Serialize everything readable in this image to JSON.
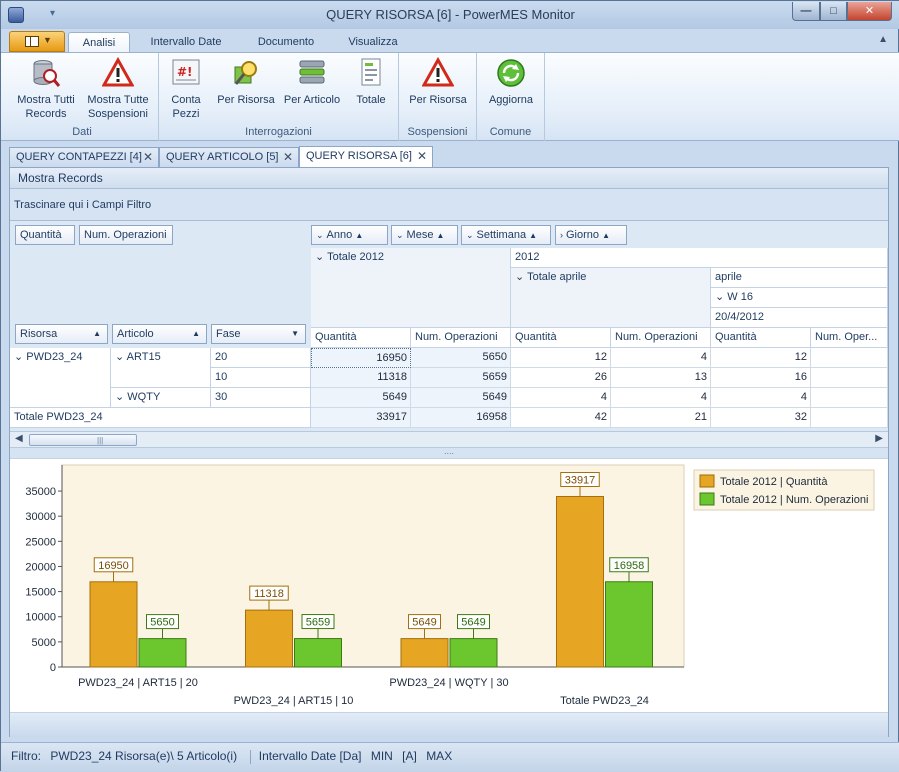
{
  "window": {
    "title": "QUERY RISORSA [6] - PowerMES Monitor",
    "minimize": "—",
    "maximize": "□",
    "close": "✕"
  },
  "ribbon": {
    "tabs": [
      "Analisi",
      "Intervallo Date",
      "Documento",
      "Visualizza"
    ],
    "active_tab": "Analisi",
    "groups": [
      {
        "label": "Dati",
        "buttons": [
          {
            "label_1": "Mostra Tutti",
            "label_2": "Records",
            "icon": "database-search-icon"
          },
          {
            "label_1": "Mostra Tutte",
            "label_2": "Sospensioni",
            "icon": "warning-triangle-icon"
          }
        ]
      },
      {
        "label": "Interrogazioni",
        "buttons": [
          {
            "label_1": "Conta",
            "label_2": "Pezzi",
            "icon": "counter-board-icon"
          },
          {
            "label_1": "Per Risorsa",
            "label_2": "",
            "icon": "resource-search-icon"
          },
          {
            "label_1": "Per Articolo",
            "label_2": "",
            "icon": "article-stack-icon"
          },
          {
            "label_1": "Totale",
            "label_2": "",
            "icon": "totals-report-icon"
          }
        ]
      },
      {
        "label": "Sospensioni",
        "buttons": [
          {
            "label_1": "Per Risorsa",
            "label_2": "",
            "icon": "warning-triangle-icon"
          }
        ]
      },
      {
        "label": "Comune",
        "buttons": [
          {
            "label_1": "Aggiorna",
            "label_2": "",
            "icon": "refresh-icon"
          }
        ]
      }
    ]
  },
  "doc_tabs": [
    {
      "label": "QUERY CONTAPEZZI [4]",
      "active": false
    },
    {
      "label": "QUERY ARTICOLO [5]",
      "active": false
    },
    {
      "label": "QUERY RISORSA [6]",
      "active": true
    }
  ],
  "panel": {
    "header": "Mostra Records",
    "filter_area": "Trascinare qui i Campi Filtro"
  },
  "pivot": {
    "data_fields": [
      "Quantità",
      "Num. Operazioni"
    ],
    "column_fields": [
      "Anno",
      "Mese",
      "Settimana",
      "Giorno"
    ],
    "row_fields": [
      "Risorsa",
      "Articolo",
      "Fase"
    ],
    "col_headers": {
      "totale_2012": "Totale 2012",
      "year": "2012",
      "totale_aprile": "Totale aprile",
      "month": "aprile",
      "week": "W 16",
      "day": "20/4/2012"
    },
    "measure_headers": [
      "Quantità",
      "Num. Operazioni",
      "Quantità",
      "Num. Operazioni",
      "Quantità",
      "Num. Oper..."
    ],
    "rows": [
      {
        "risorsa": "PWD23_24",
        "articolo": "ART15",
        "fase": "20",
        "values": [
          "16950",
          "5650",
          "12",
          "4",
          "12",
          ""
        ]
      },
      {
        "risorsa": "",
        "articolo": "",
        "fase": "10",
        "values": [
          "11318",
          "5659",
          "26",
          "13",
          "16",
          ""
        ]
      },
      {
        "risorsa": "",
        "articolo": "WQTY",
        "fase": "30",
        "values": [
          "5649",
          "5649",
          "4",
          "4",
          "4",
          ""
        ]
      }
    ],
    "total_row": {
      "label": "Totale PWD23_24",
      "values": [
        "33917",
        "16958",
        "42",
        "21",
        "32",
        ""
      ]
    }
  },
  "chart_data": {
    "type": "bar",
    "categories": [
      "PWD23_24 | ART15 | 20",
      "PWD23_24 | ART15 | 10",
      "PWD23_24 | WQTY | 30",
      "Totale PWD23_24"
    ],
    "series": [
      {
        "name": "Totale 2012 | Quantità",
        "values": [
          16950,
          11318,
          5649,
          33917
        ],
        "color": "#e6a523"
      },
      {
        "name": "Totale 2012 | Num. Operazioni",
        "values": [
          5650,
          5659,
          5649,
          16958
        ],
        "color": "#6cc72f"
      }
    ],
    "ylim": [
      0,
      37000
    ],
    "yticks": [
      "0",
      "5000",
      "10000",
      "15000",
      "20000",
      "25000",
      "30000",
      "35000"
    ],
    "xlabel": "",
    "ylabel": "",
    "legend": "top-right",
    "grid": false
  },
  "statusbar": {
    "filter_label": "Filtro:",
    "filter_value": "PWD23_24 Risorsa(e)\\ 5 Articolo(i)",
    "date_range": "Intervallo Date [Da]",
    "min": "MIN",
    "a": "[A]",
    "max": "MAX"
  }
}
